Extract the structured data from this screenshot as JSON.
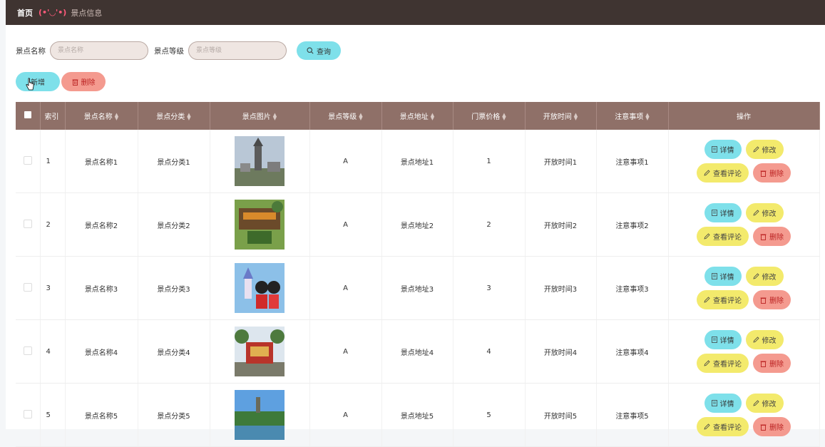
{
  "breadcrumb": {
    "home": "首页",
    "face": "(•'◡'•)",
    "current": "景点信息"
  },
  "search": {
    "name_label": "景点名称",
    "name_placeholder": "景点名称",
    "level_label": "景点等级",
    "level_placeholder": "景点等级",
    "button": "查询"
  },
  "actions": {
    "add": "新增",
    "delete": "删除"
  },
  "table": {
    "headers": [
      "索引",
      "景点名称",
      "景点分类",
      "景点图片",
      "景点等级",
      "景点地址",
      "门票价格",
      "开放时间",
      "注意事项",
      "操作"
    ],
    "row_buttons": {
      "detail": "详情",
      "edit": "修改",
      "comments": "查看评论",
      "delete": "删除"
    },
    "rows": [
      {
        "index": "1",
        "name": "景点名称1",
        "category": "景点分类1",
        "level": "A",
        "address": "景点地址1",
        "price": "1",
        "hours": "开放时间1",
        "notes": "注意事项1"
      },
      {
        "index": "2",
        "name": "景点名称2",
        "category": "景点分类2",
        "level": "A",
        "address": "景点地址2",
        "price": "2",
        "hours": "开放时间2",
        "notes": "注意事项2"
      },
      {
        "index": "3",
        "name": "景点名称3",
        "category": "景点分类3",
        "level": "A",
        "address": "景点地址3",
        "price": "3",
        "hours": "开放时间3",
        "notes": "注意事项3"
      },
      {
        "index": "4",
        "name": "景点名称4",
        "category": "景点分类4",
        "level": "A",
        "address": "景点地址4",
        "price": "4",
        "hours": "开放时间4",
        "notes": "注意事项4"
      },
      {
        "index": "5",
        "name": "景点名称5",
        "category": "景点分类5",
        "level": "A",
        "address": "景点地址5",
        "price": "5",
        "hours": "开放时间5",
        "notes": "注意事项5"
      }
    ]
  },
  "colors": {
    "topbar": "#3f3431",
    "header": "#8f7068",
    "cyan": "#7ee0ea",
    "yellow": "#f3ea6c",
    "red": "#f49a8f"
  },
  "icons": {
    "search": "search-icon",
    "cursor": "hand-pointer-icon",
    "delete": "trash-icon",
    "detail": "document-icon",
    "edit": "pencil-icon",
    "sort": "sort-icon"
  }
}
